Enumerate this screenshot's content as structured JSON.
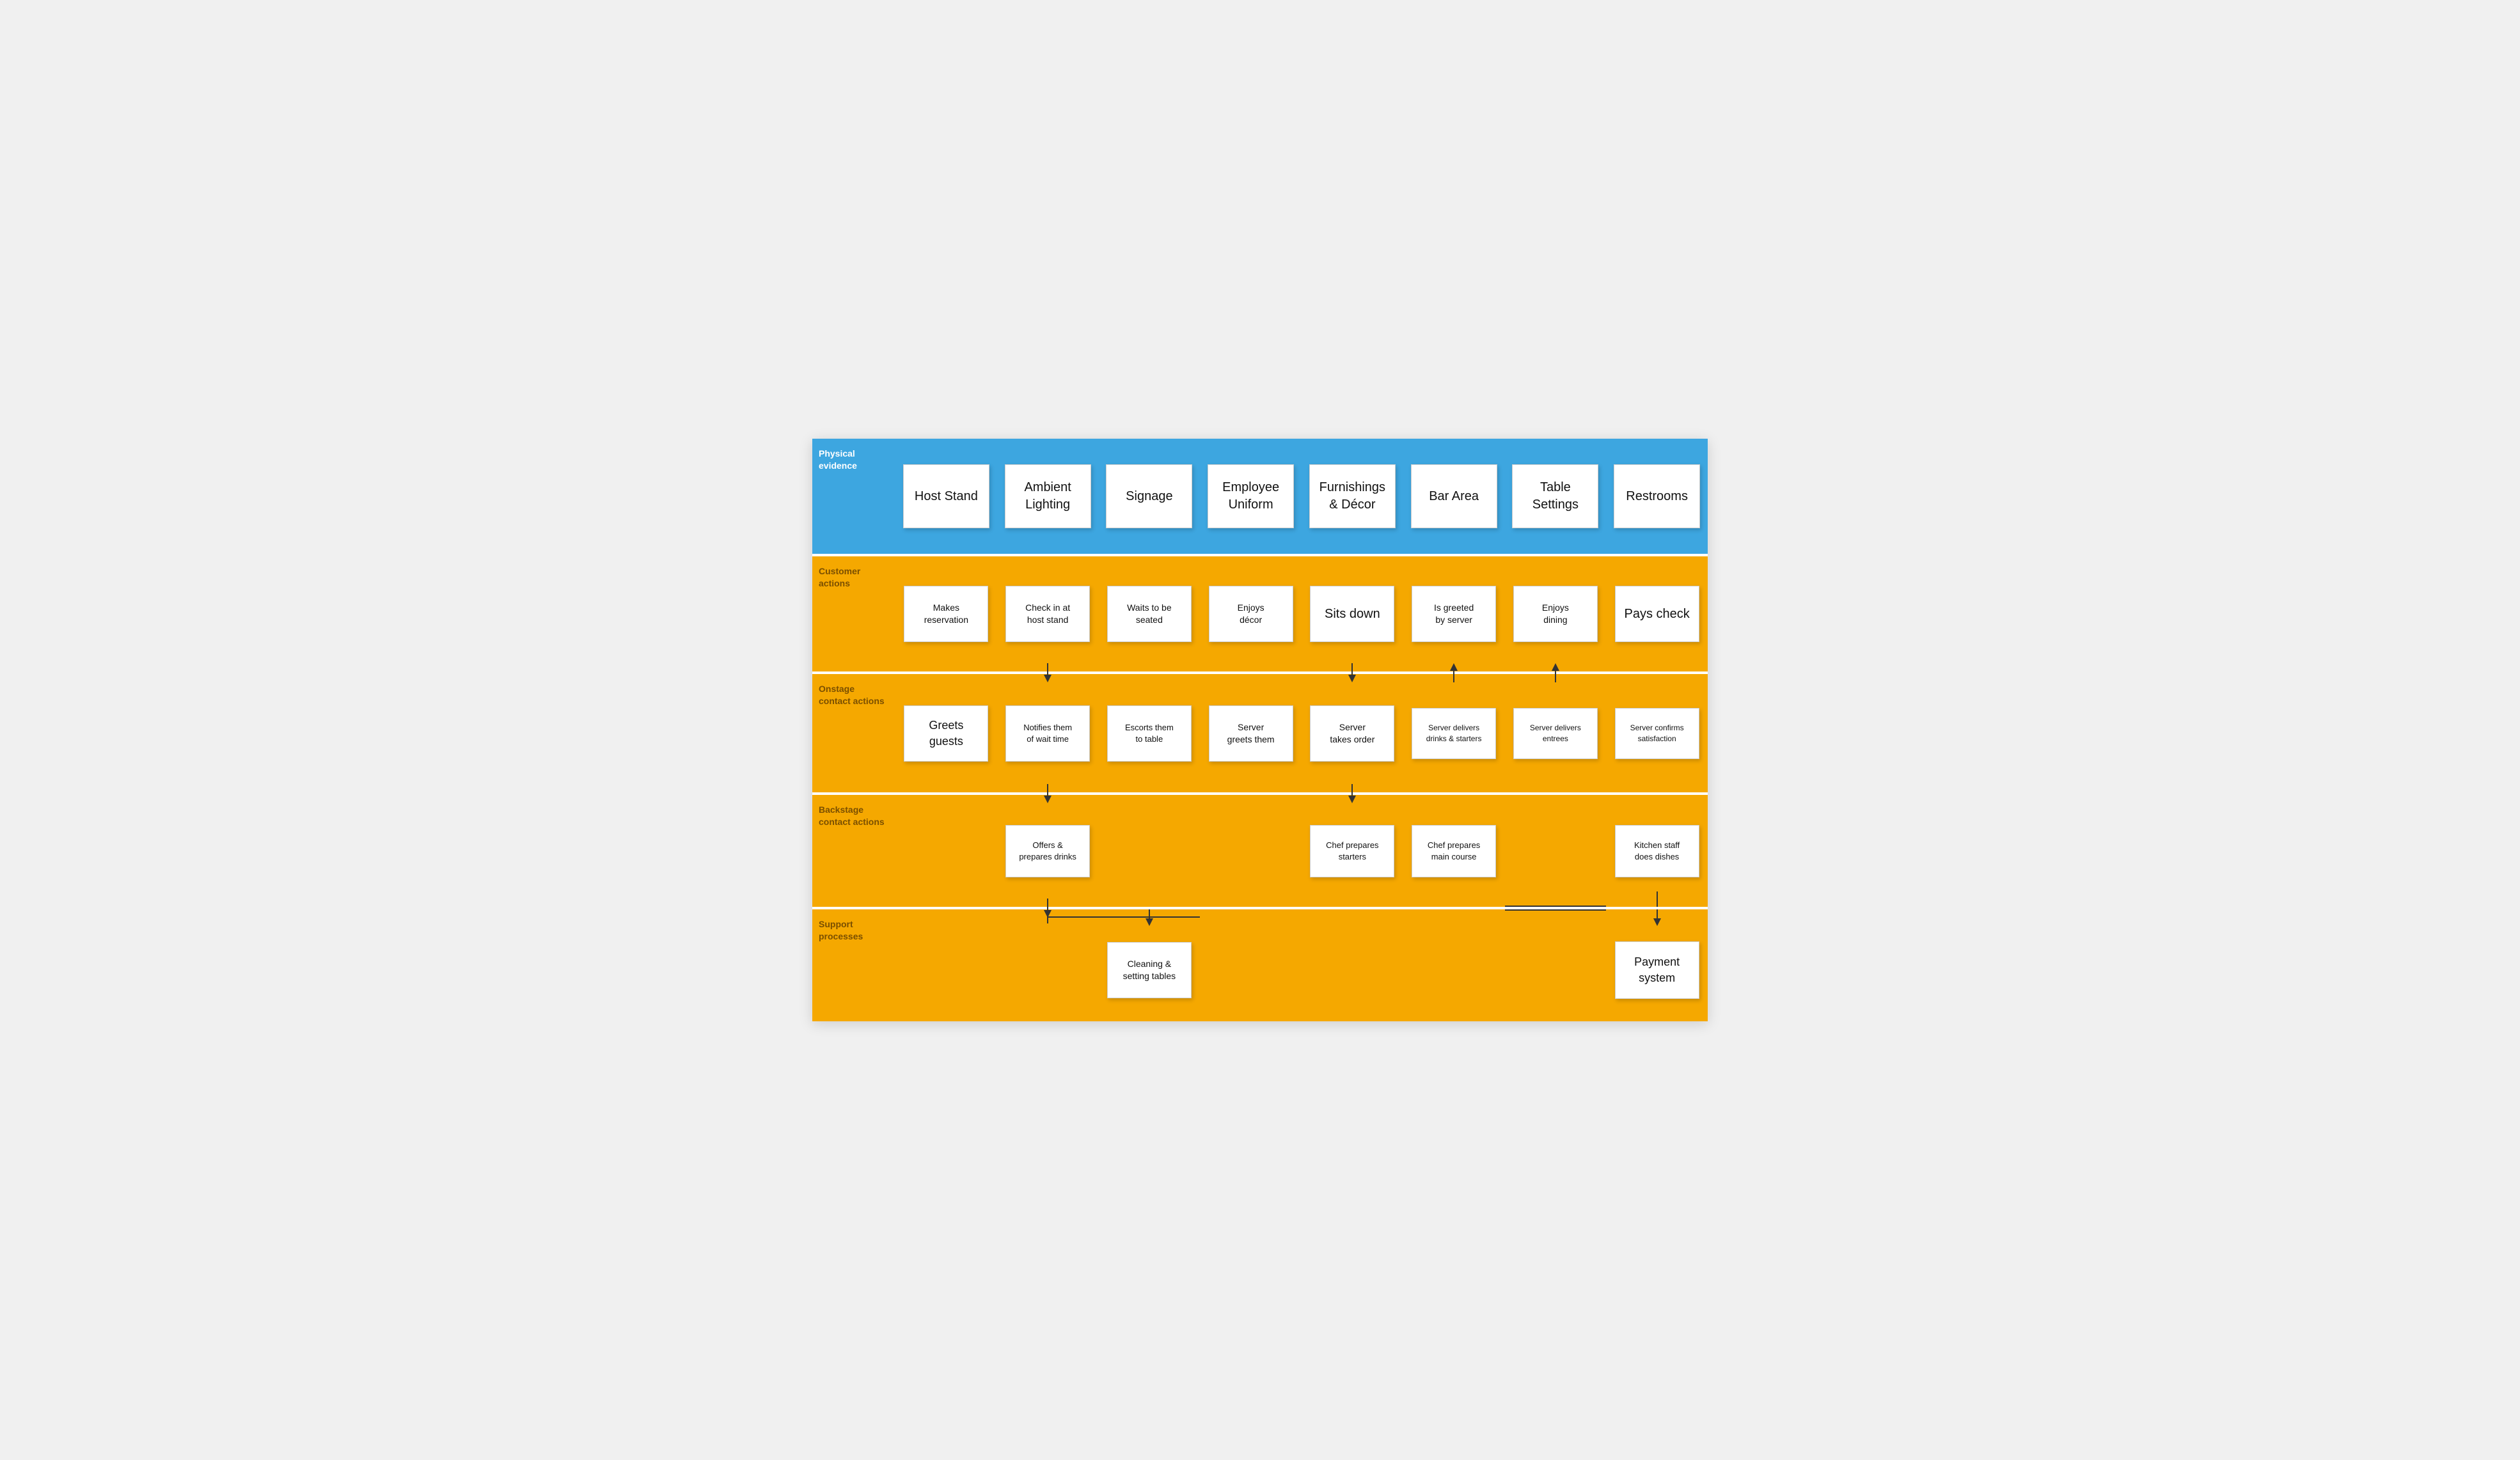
{
  "rows": {
    "physical_evidence": {
      "label": "Physical\nevidence",
      "cards": [
        "Host Stand",
        "Ambient\nLighting",
        "Signage",
        "Employee\nUniform",
        "Furnishings\n& Décor",
        "Bar Area",
        "Table\nSettings",
        "Restrooms"
      ]
    },
    "customer_actions": {
      "label": "Customer\nactions",
      "cards": [
        "Makes\nreservation",
        "Check in at\nhost stand",
        "Waits to be\nseated",
        "Enjoys\ndécor",
        "Sits down",
        "Is greeted\nby server",
        "Enjoys\ndining",
        "Pays check"
      ]
    },
    "onstage": {
      "label": "Onstage\ncontact actions",
      "cards": [
        "Greets\nguests",
        "Notifies them\nof wait time",
        "Escorts them\nto table",
        "Server\ngreets them",
        "Server\ntakes order",
        "Server delivers\ndrinks & starters",
        "Server delivers\nentrees",
        "Server confirms\nsatisfaction"
      ]
    },
    "backstage": {
      "label": "Backstage\ncontact actions",
      "cards": [
        null,
        "Offers &\nprepares drinks",
        null,
        null,
        "Chef prepares\nstarters",
        "Chef prepares\nmain course",
        null,
        "Kitchen staff\ndoes dishes"
      ]
    },
    "support": {
      "label": "Support\nprocesses",
      "cards": [
        null,
        null,
        "Cleaning &\nsetting tables",
        null,
        null,
        null,
        null,
        "Payment\nsystem"
      ]
    }
  },
  "colors": {
    "blue": "#3da6e0",
    "orange": "#f5a800",
    "card_bg": "#ffffff",
    "label_blue": "#ffffff",
    "label_orange": "#7a4f00"
  }
}
